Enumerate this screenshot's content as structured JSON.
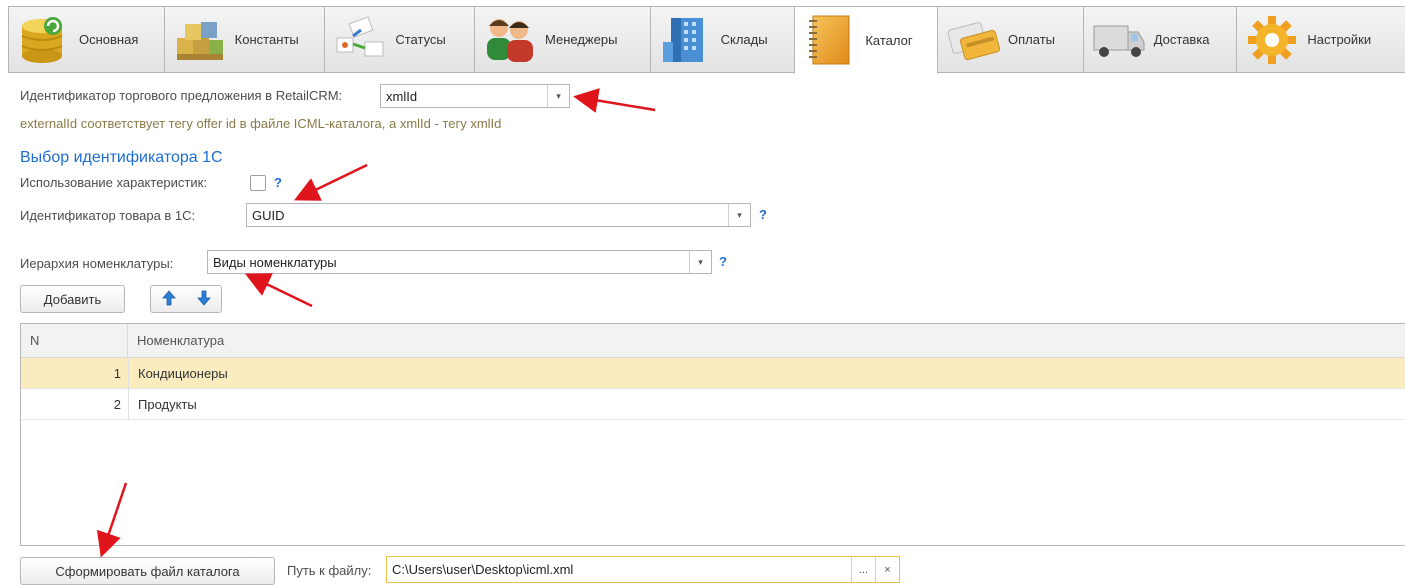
{
  "tabs": [
    {
      "label": "Основная",
      "icon": "database-icon"
    },
    {
      "label": "Константы",
      "icon": "blocks-icon"
    },
    {
      "label": "Статусы",
      "icon": "flow-icon"
    },
    {
      "label": "Менеджеры",
      "icon": "users-icon"
    },
    {
      "label": "Склады",
      "icon": "building-icon"
    },
    {
      "label": "Каталог",
      "icon": "notebook-icon",
      "active": true
    },
    {
      "label": "Оплаты",
      "icon": "card-icon"
    },
    {
      "label": "Доставка",
      "icon": "truck-icon"
    },
    {
      "label": "Настройки",
      "icon": "gear-icon"
    }
  ],
  "offer_id": {
    "label": "Идентификатор торгового предложения в RetailCRM:",
    "value": "xmlId",
    "hint": "externalId соответствует тегу offer id в файле ICML-каталога, а xmlId - тегу xmlId"
  },
  "section_title": "Выбор идентификатора 1С",
  "use_characteristics": {
    "label": "Использование характеристик:",
    "checked": false,
    "help": "?"
  },
  "product_id": {
    "label": "Идентификатор товара в 1С:",
    "value": "GUID",
    "help": "?"
  },
  "hierarchy": {
    "label": "Иерархия номенклатуры:",
    "value": "Виды номенклатуры",
    "help": "?"
  },
  "toolbar": {
    "add_label": "Добавить"
  },
  "table": {
    "columns": [
      "N",
      "Номенклатура"
    ],
    "rows": [
      {
        "n": "1",
        "name": "Кондиционеры",
        "selected": true
      },
      {
        "n": "2",
        "name": "Продукты",
        "selected": false
      }
    ]
  },
  "footer": {
    "generate_label": "Сформировать файл каталога",
    "path_label": "Путь к файлу:",
    "path_value": "C:\\Users\\user\\Desktop\\icml.xml",
    "browse_label": "...",
    "clear_label": "×"
  },
  "colors": {
    "accent": "#1c6ed4",
    "selected_row": "#fbecc0",
    "annotation_arrow": "#e0141b"
  }
}
